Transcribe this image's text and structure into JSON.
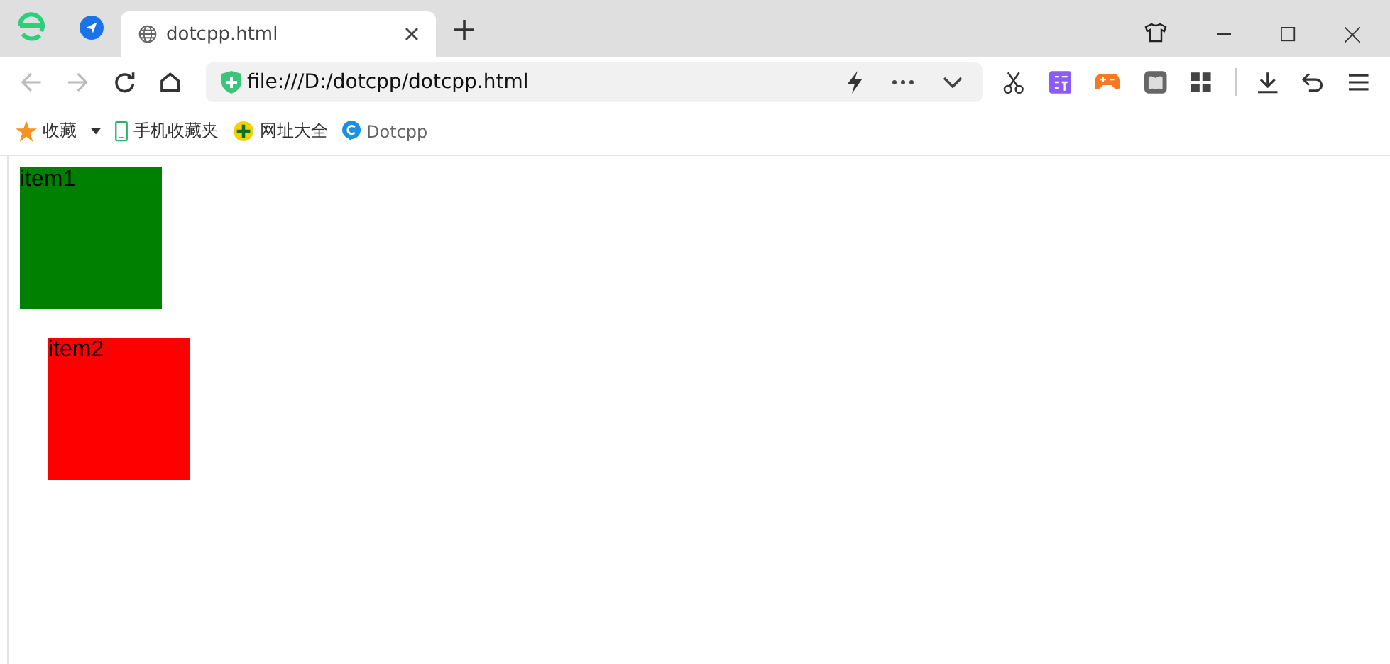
{
  "tabs": [
    {
      "title": "dotcpp.html",
      "selected": true
    }
  ],
  "address_bar": {
    "url": "file:///D:/dotcpp/dotcpp.html"
  },
  "bookmarks": [
    {
      "label": "收藏",
      "kind": "star"
    },
    {
      "label": "手机收藏夹",
      "kind": "phone"
    },
    {
      "label": "网址大全",
      "kind": "sites"
    },
    {
      "label": "Dotcpp",
      "kind": "site"
    }
  ],
  "page": {
    "boxes": [
      {
        "label": "item1",
        "color": "#008000"
      },
      {
        "label": "item2",
        "color": "#ff0000"
      }
    ]
  }
}
